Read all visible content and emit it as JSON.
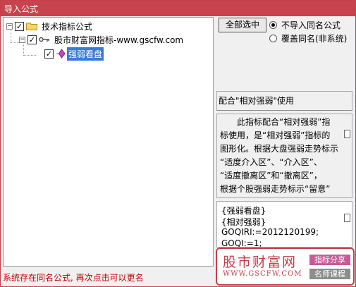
{
  "window": {
    "title": "导入公式"
  },
  "tree": {
    "root_label": "技术指标公式",
    "child_label": "股市财富网指标-www.gscfw.com",
    "leaf_label": "强弱看盘",
    "expand_symbol": "−",
    "check_symbol": "✓"
  },
  "options": {
    "select_all_label": "全部选中",
    "radio_no_import": "不导入同名公式",
    "radio_overwrite": "覆盖同名(非系统)"
  },
  "usage_text": "配合\"相对强弱\"使用",
  "description": {
    "lines": [
      "此指标配合“相对强弱”指",
      "标使用，是“相对强弱”指标的",
      "图形化。根据大盘强弱走势标示",
      "“适度介入区”、“介入区”、",
      "“适度撤离区”和“撤离区”，",
      "根据个股强弱走势标示“留意”"
    ]
  },
  "code": {
    "lines": [
      "{强弱看盘}",
      "{相对强弱}",
      "GOQIRI:=2012120199;",
      "GOQI:=1;"
    ]
  },
  "status_text": "系统存在同名公式, 再次点击可以更名",
  "watermark": {
    "brand": "股市财富网",
    "url": "WWW.GSCFW.COM",
    "tag1": "指标分享",
    "tag2": "名师课程"
  },
  "colors": {
    "title_bar": "#c7434d",
    "selection": "#3a7ad8",
    "status": "#c00000"
  }
}
